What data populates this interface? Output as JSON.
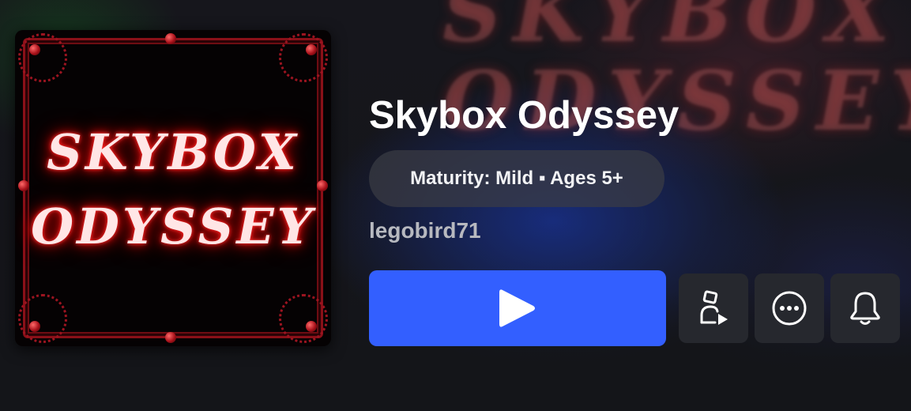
{
  "experience": {
    "title": "Skybox Odyssey",
    "maturity": "Maturity: Mild ▪ Ages 5+",
    "creator": "legobird71",
    "thumbnail_text_line1": "SKYBOX",
    "thumbnail_text_line2": "ODYSSEY",
    "background_text": "SKYBOX\nODYSSEY"
  },
  "actions": {
    "play_icon": "play-icon",
    "invite_icon": "party-invite-icon",
    "more_icon": "more-options-icon",
    "notify_icon": "bell-icon"
  },
  "colors": {
    "play_button": "#335fff",
    "secondary_button": "#26282e",
    "background": "#141519",
    "thumbnail_glow": "#e01010"
  }
}
